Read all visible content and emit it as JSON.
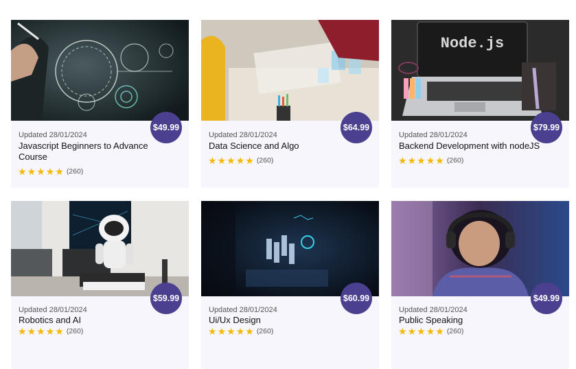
{
  "courses": [
    {
      "updated": "Updated 28/01/2024",
      "title": "Javascript Beginners to Advance Course",
      "price": "$49.99",
      "stars": 5,
      "count": "(260)",
      "image": "training-hologram"
    },
    {
      "updated": "Updated 28/01/2024",
      "title": "Data Science and Algo",
      "price": "$64.99",
      "stars": 5,
      "count": "(260)",
      "image": "team-charts-desk"
    },
    {
      "updated": "Updated 28/01/2024",
      "title": "Backend Development with nodeJS",
      "price": "$79.99",
      "stars": 5,
      "count": "(260)",
      "image": "laptop-nodejs",
      "image_text": "Node.js"
    },
    {
      "updated": "Updated 28/01/2024",
      "title": "Robotics and AI",
      "price": "$59.99",
      "stars": 5,
      "count": "(260)",
      "image": "astronaut-desk"
    },
    {
      "updated": "Updated 28/01/2024",
      "title": "Ui/Ux Design",
      "price": "$60.99",
      "stars": 5,
      "count": "(260)",
      "image": "hologram-ui-dark"
    },
    {
      "updated": "Updated 28/01/2024",
      "title": "Public Speaking",
      "price": "$49.99",
      "stars": 5,
      "count": "(260)",
      "image": "woman-headset"
    }
  ],
  "colors": {
    "price_badge": "#4b4090",
    "star": "#f5b800",
    "card_bg": "#f7f6fd"
  }
}
